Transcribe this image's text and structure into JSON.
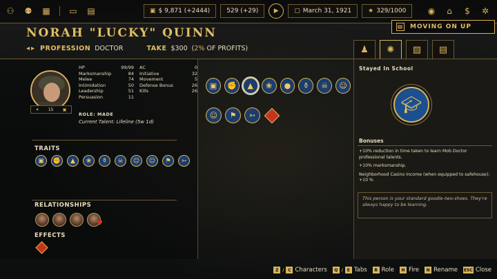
{
  "top": {
    "money": "$ 9,871 (+2444)",
    "influence": "529 (+29)",
    "date": "March 31, 1921",
    "heat": "329/1000",
    "left_icons": [
      "people-icon",
      "family-icon",
      "map-icon",
      "folder-icon"
    ],
    "right_icons": [
      "mask-icon",
      "building-icon",
      "dollar-icon",
      "gear-icon"
    ]
  },
  "header": {
    "name": "NORAH \"LUCKY\" QUINN",
    "profession_label": "PROFESSION",
    "profession_value": "DOCTOR",
    "take_label": "TAKE",
    "take_amount": "$300",
    "take_pct_open": "(",
    "take_pct": "2%",
    "take_pct_rest": "OF PROFITS)"
  },
  "moving_on_up": "MOVING ON UP",
  "tabs": [
    "user-tab-icon",
    "gear-tab-icon",
    "cards-tab-icon",
    "ledger-tab-icon"
  ],
  "character": {
    "level": "15",
    "stats_left": [
      {
        "k": "HP",
        "v": "99/99"
      },
      {
        "k": "Marksmanship",
        "v": "84"
      },
      {
        "k": "Melee",
        "v": "74"
      },
      {
        "k": "Intimidation",
        "v": "50"
      },
      {
        "k": "Leadership",
        "v": "51"
      },
      {
        "k": "Persuasion",
        "v": "11"
      }
    ],
    "stats_right": [
      {
        "k": "AC",
        "v": "0"
      },
      {
        "k": "Initiative",
        "v": "32"
      },
      {
        "k": "Movement",
        "v": "5"
      },
      {
        "k": "Defense Bonus",
        "v": "26"
      },
      {
        "k": "Kills",
        "v": "26"
      }
    ],
    "role_label": "ROLE:",
    "role_value": "MADE",
    "talent": "Current Talent: Lifeline (5w 1d)"
  },
  "sections": {
    "traits": "TRAITS",
    "relationships": "RELATIONSHIPS",
    "effects": "EFFECTS"
  },
  "traits": [
    "briefcase",
    "muscle",
    "grad-cap",
    "flower",
    "broken-bottle",
    "skull",
    "face",
    "face",
    "runner",
    "gun"
  ],
  "mid_icons_row1": [
    "briefcase",
    "muscle",
    "grad-cap",
    "flower",
    "pig",
    "broken-bottle",
    "skull",
    "face"
  ],
  "mid_icons_row2": [
    "face",
    "runner",
    "gun",
    "hazard"
  ],
  "right": {
    "title": "Stayed In School",
    "bonuses_title": "Bonuses",
    "bonuses": [
      "+10% reduction in time taken to learn Mob Doctor professional talents.",
      "+10% marksmanship.",
      "Neighborhood Casino Income (when equipped to safehouse): +10 %"
    ],
    "flavor": "This person is your standard goodie-two-shoes. They're always happy to be learning."
  },
  "keys": [
    {
      "k1": "Z",
      "k2": "C",
      "label": "Characters"
    },
    {
      "k1": "Q",
      "k2": "E",
      "label": "Tabs"
    },
    {
      "k1": "R",
      "k2": "",
      "label": "Role"
    },
    {
      "k1": "H",
      "k2": "",
      "label": "Fire"
    },
    {
      "k1": "N",
      "k2": "",
      "label": "Rename"
    },
    {
      "k1": "ESC",
      "k2": "",
      "label": "Close"
    }
  ]
}
